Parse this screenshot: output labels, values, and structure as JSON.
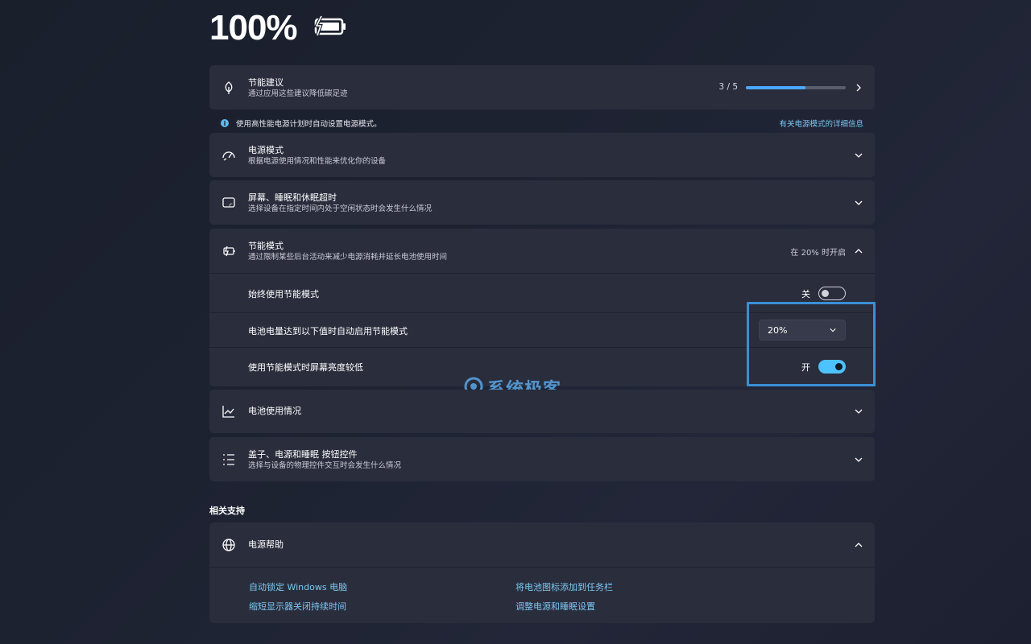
{
  "battery": {
    "percent": "100%",
    "icon": "battery-charging-icon"
  },
  "energy_recommendations": {
    "title": "节能建议",
    "subtitle": "通过应用这些建议降低碳足迹",
    "progress_text": "3 / 5",
    "progress_fraction": 0.6
  },
  "info_bar": {
    "text": "使用高性能电源计划时自动设置电源模式。",
    "link": "有关电源模式的详细信息"
  },
  "power_mode": {
    "title": "电源模式",
    "subtitle": "根据电源使用情况和性能来优化你的设备"
  },
  "screen_sleep": {
    "title": "屏幕、睡眠和休眠超时",
    "subtitle": "选择设备在指定时间内处于空闲状态时会发生什么情况"
  },
  "battery_saver": {
    "title": "节能模式",
    "subtitle": "通过限制某些后台活动来减少电源消耗并延长电池使用时间",
    "status": "在 20% 时开启",
    "always_on": {
      "label": "始终使用节能模式",
      "state_label": "关",
      "on": false
    },
    "auto_on": {
      "label": "电池电量达到以下值时自动启用节能模式",
      "value": "20%"
    },
    "lower_brightness": {
      "label": "使用节能模式时屏幕亮度较低",
      "state_label": "开",
      "on": true
    }
  },
  "battery_usage": {
    "title": "电池使用情况"
  },
  "lid_buttons": {
    "title": "盖子、电源和睡眠 按钮控件",
    "subtitle": "选择与设备的物理控件交互时会发生什么情况"
  },
  "related_support": {
    "heading": "相关支持",
    "power_help": {
      "title": "电源帮助",
      "links": [
        "自动锁定 Windows 电脑",
        "将电池图标添加到任务栏",
        "缩短显示器关闭持续时间",
        "调整电源和睡眠设置"
      ]
    }
  },
  "watermark": {
    "text": "系统极客"
  },
  "colors": {
    "accent": "#4cc2ff",
    "highlight": "#3a8fd6",
    "link": "#7cc7f2",
    "card": "#2a2d3c"
  }
}
